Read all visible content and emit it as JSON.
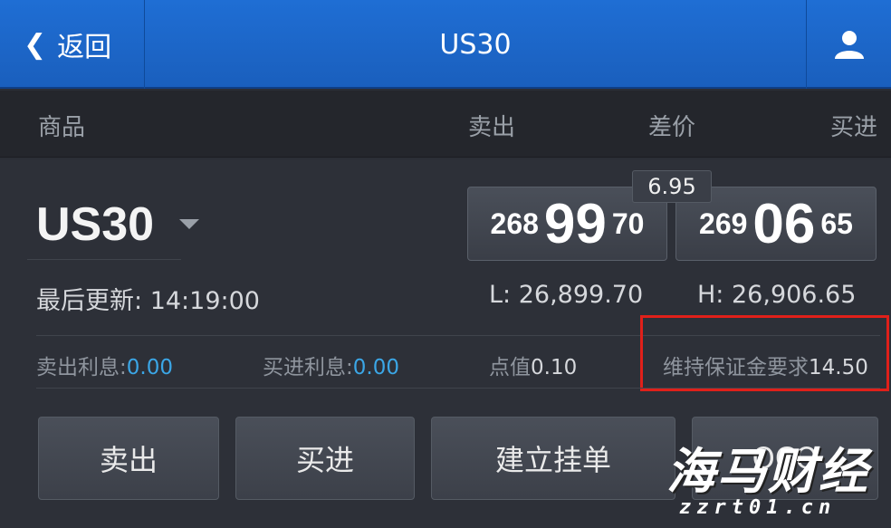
{
  "topbar": {
    "back_label": "返回",
    "title": "US30"
  },
  "header": {
    "product": "商品",
    "sell": "卖出",
    "spread": "差价",
    "buy": "买进"
  },
  "instrument": {
    "symbol": "US30",
    "spread": "6.95",
    "sell_price": {
      "prefix": "268",
      "big": "99",
      "suffix": "70"
    },
    "buy_price": {
      "prefix": "269",
      "big": "06",
      "suffix": "65"
    },
    "last_update_label": "最后更新:",
    "last_update_time": "14:19:00",
    "low_label": "L:",
    "low_value": "26,899.70",
    "high_label": "H:",
    "high_value": "26,906.65"
  },
  "info": {
    "sell_interest_label": "卖出利息:",
    "sell_interest_value": "0.00",
    "buy_interest_label": "买进利息:",
    "buy_interest_value": "0.00",
    "point_value_label": "点值",
    "point_value": "0.10",
    "margin_label": "维持保证金要求",
    "margin_value": "14.50"
  },
  "actions": {
    "sell": "卖出",
    "buy": "买进",
    "pending_order": "建立挂单",
    "oco": "OCO"
  },
  "watermark": {
    "main": "海马财经",
    "sub": "zzrt01.cn"
  },
  "colors": {
    "topbar": "#1f6ed4",
    "highlight": "#e0201a",
    "interest_value": "#3ba6e6"
  },
  "icons": [
    "chevron-left-icon",
    "user-icon",
    "caret-down-icon"
  ]
}
